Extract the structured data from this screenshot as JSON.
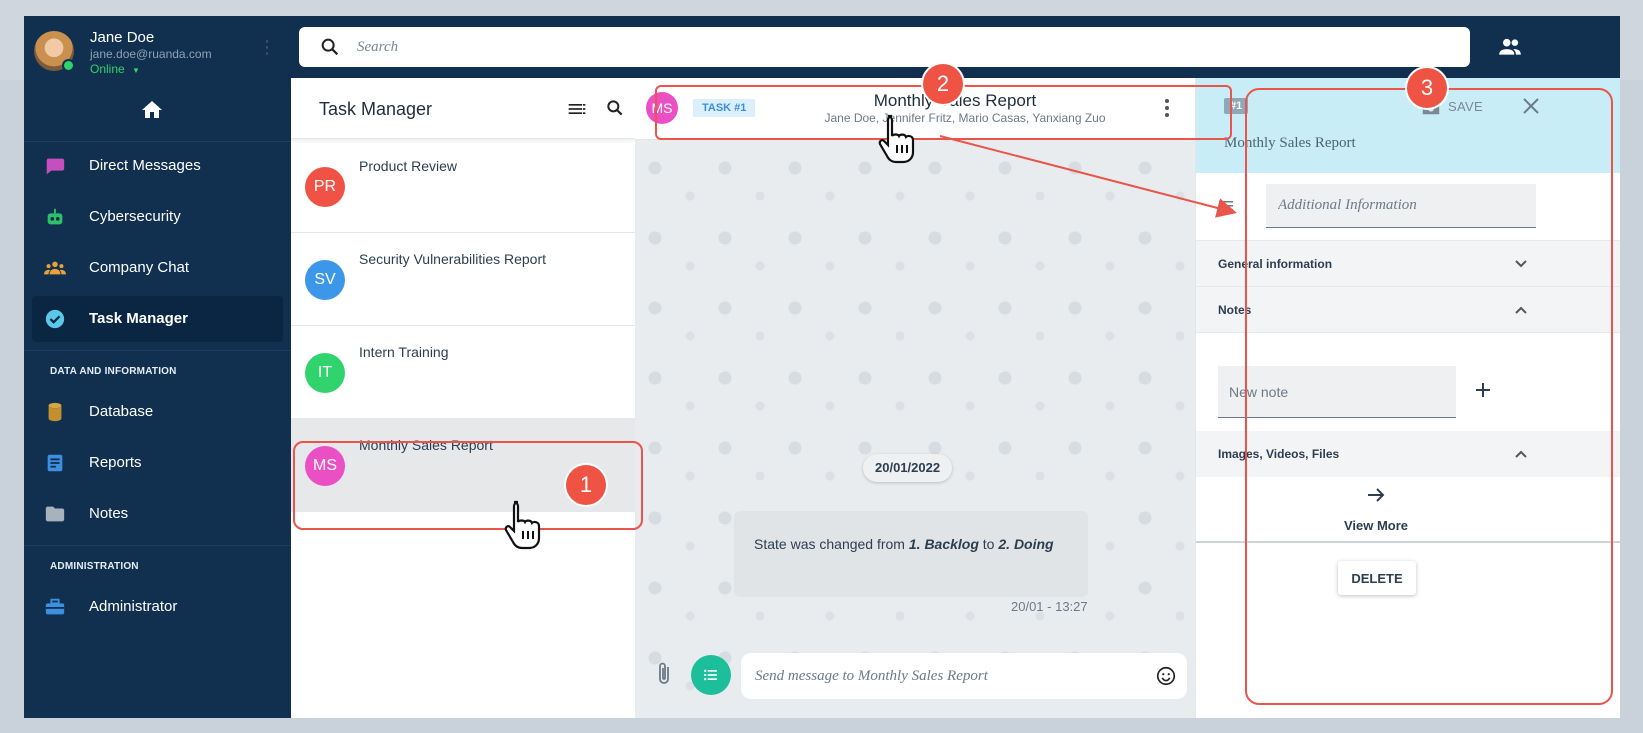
{
  "user": {
    "name": "Jane Doe",
    "email": "jane.doe@ruanda.com",
    "status": "Online"
  },
  "search": {
    "placeholder": "Search"
  },
  "sidebar": {
    "items": [
      {
        "label": "Direct Messages",
        "icon": "chat-bubble-icon"
      },
      {
        "label": "Cybersecurity",
        "icon": "robot-icon"
      },
      {
        "label": "Company Chat",
        "icon": "group-icon"
      },
      {
        "label": "Task Manager",
        "icon": "check-circle-icon"
      }
    ],
    "section_data": "DATA AND INFORMATION",
    "data_items": [
      {
        "label": "Database",
        "icon": "database-icon"
      },
      {
        "label": "Reports",
        "icon": "report-icon"
      },
      {
        "label": "Notes",
        "icon": "folder-icon"
      }
    ],
    "section_admin": "ADMINISTRATION",
    "admin_items": [
      {
        "label": "Administrator",
        "icon": "toolbox-icon"
      }
    ]
  },
  "tasklist": {
    "title": "Task Manager",
    "tasks": [
      {
        "initials": "PR",
        "title": "Product Review",
        "color": "#f05345"
      },
      {
        "initials": "SV",
        "title": "Security Vulnerabilities Report",
        "color": "#3d97e8"
      },
      {
        "initials": "IT",
        "title": "Intern Training",
        "color": "#31d36c"
      },
      {
        "initials": "MS",
        "title": "Monthly Sales Report",
        "color": "#ea4fc3"
      }
    ]
  },
  "chat": {
    "avatar": "MS",
    "badge": "TASK #1",
    "title": "Monthly Sales Report",
    "members": "Jane Doe, Jennifer Fritz, Mario Casas, Yanxiang Zuo",
    "date": "20/01/2022",
    "message_prefix": "State was changed from ",
    "message_from": "1. Backlog",
    "message_mid": " to ",
    "message_to": "2. Doing",
    "message_time": "20/01 - 13:27",
    "composer_placeholder": "Send message to Monthly Sales Report"
  },
  "details": {
    "id": "#1",
    "save": "SAVE",
    "title": "Monthly Sales Report",
    "additional_placeholder": "Additional Information",
    "general": "General information",
    "notes": "Notes",
    "note_placeholder": "New note",
    "files": "Images, Videos, Files",
    "view_more": "View More",
    "delete": "DELETE"
  },
  "steps": [
    "1",
    "2",
    "3"
  ],
  "colors": {
    "accent": "#ef5343",
    "sidebar": "#11304f",
    "teal": "#1dbf9b"
  }
}
